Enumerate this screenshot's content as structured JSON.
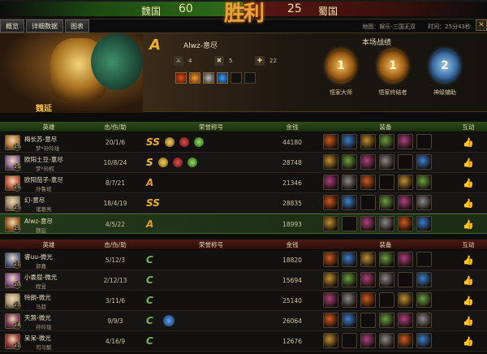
{
  "top": {
    "wei_name": "魏国",
    "wei_score": "60",
    "shu_name": "蜀国",
    "shu_score": "25",
    "emblem_text": "胜利"
  },
  "tabs": [
    "概览",
    "详细数据",
    "图表"
  ],
  "info": {
    "map": "地图：娱乐-三国无双",
    "time": "时间：25分43秒"
  },
  "banner": {
    "hero_name": "魏延",
    "rank": "A",
    "player": "Alwz-意尽",
    "kills": "4",
    "deaths": "5",
    "assists": "22",
    "battle_title": "本场战绩",
    "medals": [
      {
        "label": "悟家大师",
        "value": "1",
        "color": "gold"
      },
      {
        "label": "悟家终结者",
        "value": "1",
        "color": "gold"
      },
      {
        "label": "神级辅助",
        "value": "2",
        "color": "blue"
      }
    ]
  },
  "headers": {
    "hero": "英雄",
    "kda": "击/伤/助",
    "honor": "荣誉称号",
    "gold": "金钱",
    "equip": "装备",
    "interact": "互动"
  },
  "wei_rows": [
    {
      "player": "梅长苏-意尽",
      "hero": "梦*孙玲珑",
      "level": "25",
      "kda": "20/1/6",
      "gold": "44180",
      "rank": "SS",
      "avatar": "#b3773a"
    },
    {
      "player": "欧阳土豆-意尽",
      "hero": "梦*孙权",
      "level": "25",
      "kda": "10/8/24",
      "gold": "28748",
      "rank": "S",
      "avatar": "#8a6a9a"
    },
    {
      "player": "欧阳茄子-意尽",
      "hero": "孙鲁班",
      "level": "25",
      "kda": "8/7/21",
      "gold": "21346",
      "rank": "A",
      "avatar": "#c05a40"
    },
    {
      "player": "幻-意尽",
      "hero": "诸葛亮",
      "level": "25",
      "kda": "18/4/19",
      "gold": "28835",
      "rank": "SS",
      "avatar": "#9a8a70"
    },
    {
      "player": "Alwz-意尽",
      "hero": "魏延",
      "level": "25",
      "kda": "4/5/22",
      "gold": "18993",
      "rank": "A",
      "avatar": "#a0602a",
      "self": true
    }
  ],
  "shu_rows": [
    {
      "player": "睿uu-微光",
      "hero": "郭嘉",
      "level": "21",
      "kda": "5/12/3",
      "gold": "18820",
      "rank": "C",
      "avatar": "#5a6a9a"
    },
    {
      "player": "小委屈-微光",
      "hero": "程昱",
      "level": "20",
      "kda": "2/12/13",
      "gold": "15694",
      "rank": "C",
      "avatar": "#8a5a9a"
    },
    {
      "player": "特朗-微光",
      "hero": "马超",
      "level": "23",
      "kda": "3/11/6",
      "gold": "25140",
      "rank": "C",
      "avatar": "#aa9a7a"
    },
    {
      "player": "天煞-微光",
      "hero": "孙玲珑",
      "level": "24",
      "kda": "9/9/3",
      "gold": "26064",
      "rank": "C",
      "avatar": "#7a3a5a"
    },
    {
      "player": "呆呆-微光",
      "hero": "司马懿",
      "level": "21",
      "kda": "4/16/9",
      "gold": "12676",
      "rank": "C",
      "avatar": "#9a3a3a"
    }
  ]
}
